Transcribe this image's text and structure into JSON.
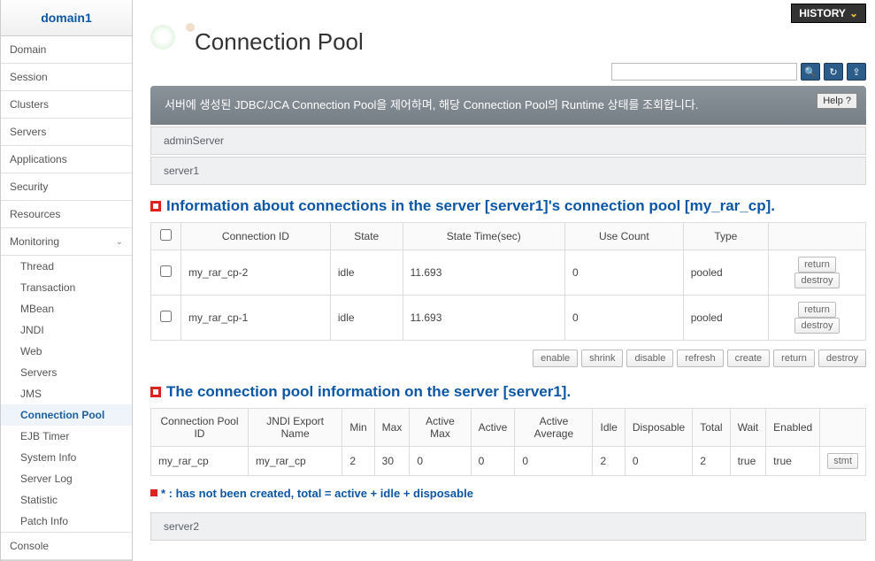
{
  "sidebar": {
    "header": "domain1",
    "items": [
      {
        "label": "Domain"
      },
      {
        "label": "Session"
      },
      {
        "label": "Clusters"
      },
      {
        "label": "Servers"
      },
      {
        "label": "Applications"
      },
      {
        "label": "Security"
      },
      {
        "label": "Resources"
      },
      {
        "label": "Monitoring",
        "expanded": true
      }
    ],
    "sub_items": [
      {
        "label": "Thread"
      },
      {
        "label": "Transaction"
      },
      {
        "label": "MBean"
      },
      {
        "label": "JNDI"
      },
      {
        "label": "Web"
      },
      {
        "label": "Servers"
      },
      {
        "label": "JMS"
      },
      {
        "label": "Connection Pool",
        "active": true
      },
      {
        "label": "EJB Timer"
      },
      {
        "label": "System Info"
      },
      {
        "label": "Server Log"
      },
      {
        "label": "Statistic"
      },
      {
        "label": "Patch Info"
      }
    ],
    "footer": "Console"
  },
  "header": {
    "history": "HISTORY",
    "title": "Connection Pool",
    "help": "Help ?"
  },
  "description": "서버에 생성된 JDBC/JCA Connection Pool을 제어하며, 해당 Connection Pool의 Runtime 상태를 조회합니다.",
  "servers": {
    "admin": "adminServer",
    "s1": "server1",
    "s2": "server2"
  },
  "section1": {
    "title": "Information about connections in the server [server1]'s connection pool [my_rar_cp].",
    "columns": {
      "c1": "Connection ID",
      "c2": "State",
      "c3": "State Time(sec)",
      "c4": "Use Count",
      "c5": "Type"
    },
    "rows": [
      {
        "id": "my_rar_cp-2",
        "state": "idle",
        "time": "11.693",
        "use": "0",
        "type": "pooled"
      },
      {
        "id": "my_rar_cp-1",
        "state": "idle",
        "time": "11.693",
        "use": "0",
        "type": "pooled"
      }
    ],
    "row_btns": {
      "return": "return",
      "destroy": "destroy"
    }
  },
  "action_bar": {
    "enable": "enable",
    "shrink": "shrink",
    "disable": "disable",
    "refresh": "refresh",
    "create": "create",
    "return": "return",
    "destroy": "destroy"
  },
  "section2": {
    "title": "The connection pool information on the server [server1].",
    "columns": {
      "c1": "Connection Pool ID",
      "c2": "JNDI Export Name",
      "c3": "Min",
      "c4": "Max",
      "c5": "Active Max",
      "c6": "Active",
      "c7": "Active Average",
      "c8": "Idle",
      "c9": "Disposable",
      "c10": "Total",
      "c11": "Wait",
      "c12": "Enabled"
    },
    "row": {
      "id": "my_rar_cp",
      "jndi": "my_rar_cp",
      "min": "2",
      "max": "30",
      "amax": "0",
      "active": "0",
      "aavg": "0",
      "idle": "2",
      "disp": "0",
      "total": "2",
      "wait": "true",
      "enabled": "true",
      "stmt": "stmt"
    }
  },
  "note": "* : has not been created, total = active + idle + disposable"
}
